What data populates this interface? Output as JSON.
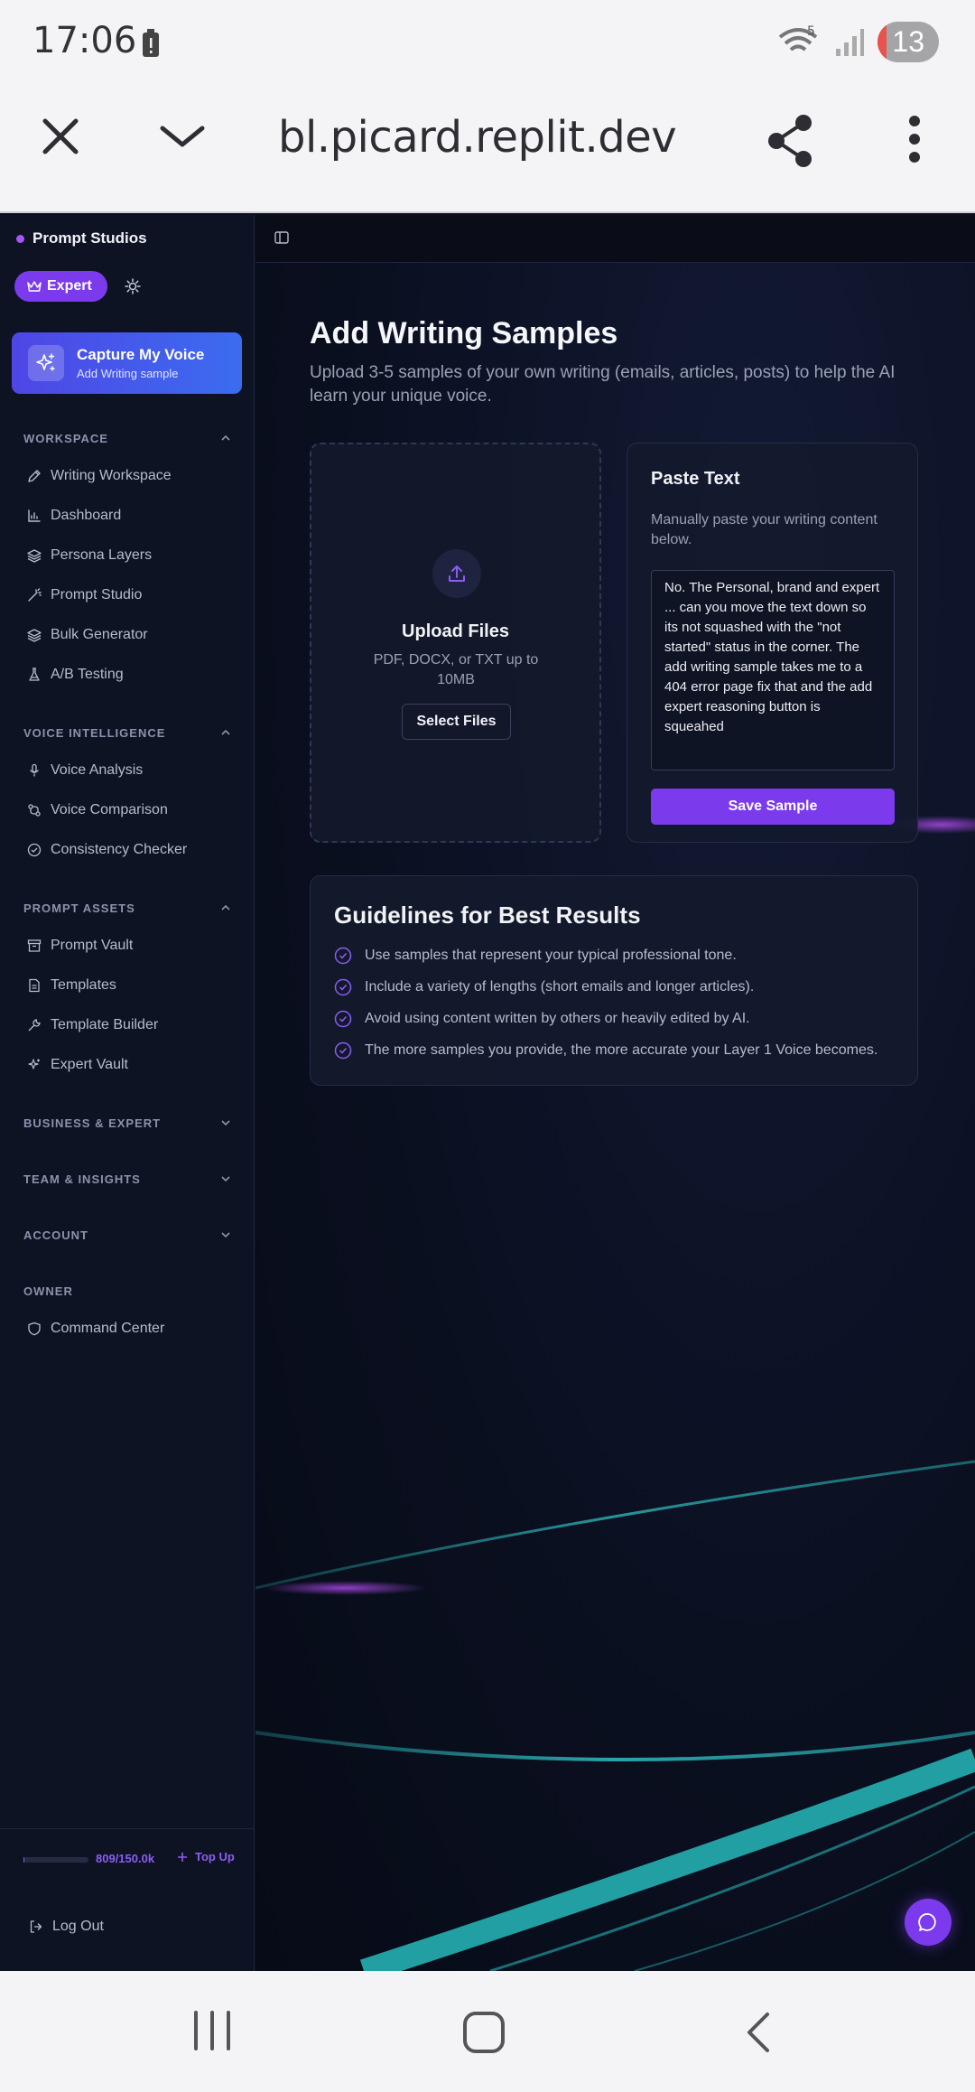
{
  "status_bar": {
    "time": "17:06",
    "notification_count": "13",
    "wifi_label": "5"
  },
  "browser": {
    "url": "bl.picard.replit.dev"
  },
  "sidebar": {
    "brand": "Prompt Studios",
    "plan_badge": "Expert",
    "capture": {
      "title": "Capture My Voice",
      "subtitle": "Add Writing sample"
    },
    "sections": [
      {
        "title": "WORKSPACE",
        "items": [
          "Writing Workspace",
          "Dashboard",
          "Persona Layers",
          "Prompt Studio",
          "Bulk Generator",
          "A/B Testing"
        ]
      },
      {
        "title": "VOICE INTELLIGENCE",
        "items": [
          "Voice Analysis",
          "Voice Comparison",
          "Consistency Checker"
        ]
      },
      {
        "title": "PROMPT ASSETS",
        "items": [
          "Prompt Vault",
          "Templates",
          "Template Builder",
          "Expert Vault"
        ]
      },
      {
        "title": "BUSINESS & EXPERT",
        "items": []
      },
      {
        "title": "TEAM & INSIGHTS",
        "items": []
      },
      {
        "title": "ACCOUNT",
        "items": []
      },
      {
        "title": "OWNER",
        "items": [
          "Command Center"
        ]
      }
    ],
    "tokens": "809/150.0k",
    "token_fraction": 0.0054,
    "top_up": "Top Up",
    "logout": "Log Out"
  },
  "main": {
    "title": "Add Writing Samples",
    "subtitle": "Upload 3-5 samples of your own writing (emails, articles, posts) to help the AI learn your unique voice.",
    "upload": {
      "title": "Upload Files",
      "subtitle": "PDF, DOCX, or TXT up to 10MB",
      "button": "Select Files"
    },
    "paste": {
      "title": "Paste Text",
      "subtitle": "Manually paste your writing content below.",
      "value": "No. The Personal, brand and expert ... can you move the text down so its not squashed with the \"not started\" status in the corner. The  add writing sample takes me to a 404 error page fix that and the add expert reasoning button is squeahed",
      "button": "Save Sample"
    },
    "guidelines": {
      "title": "Guidelines for Best Results",
      "items": [
        "Use samples that represent your typical professional tone.",
        "Include a variety of lengths (short emails and longer articles).",
        "Avoid using content written by others or heavily edited by AI.",
        "The more samples you provide, the more accurate your Layer 1 Voice becomes."
      ]
    }
  },
  "colors": {
    "accent": "#7c3aed",
    "capture_gradient_start": "#4f46e5",
    "capture_gradient_end": "#3b6cf0",
    "background": "#0b0f1e",
    "glow_cyan": "#2dd4d4"
  },
  "icons": [
    "close-icon",
    "chevron-down-icon",
    "share-icon",
    "more-vert-icon",
    "crown-icon",
    "sun-icon",
    "sparkles-icon",
    "pen-icon",
    "chart-icon",
    "layers-icon",
    "wand-icon",
    "flask-icon",
    "mic-icon",
    "compare-icon",
    "check-circle-icon",
    "archive-icon",
    "file-icon",
    "wrench-icon",
    "shield-icon",
    "logout-icon",
    "upload-icon",
    "chat-icon",
    "panel-icon"
  ]
}
